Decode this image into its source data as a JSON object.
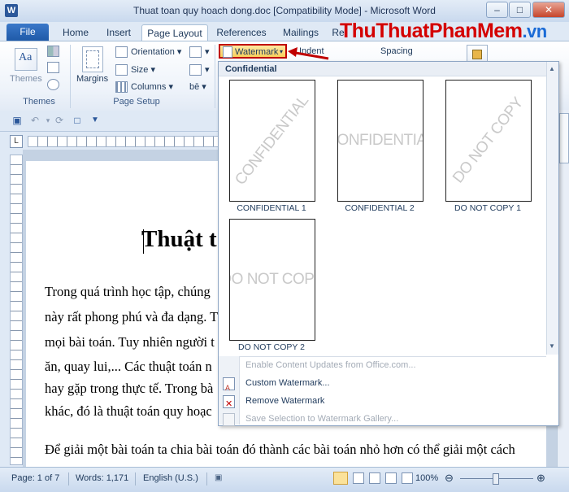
{
  "window": {
    "title": "Thuat toan quy hoach dong.doc [Compatibility Mode] - Microsoft Word",
    "app_icon": "W",
    "controls": {
      "minimize": "–",
      "maximize": "□",
      "close": "✕"
    }
  },
  "brand_watermark": {
    "main": "ThuThuatPhanMem",
    "suffix": ".vn"
  },
  "tabs": {
    "file": "File",
    "home": "Home",
    "insert": "Insert",
    "page_layout": "Page Layout",
    "references": "References",
    "mailings": "Mailings",
    "review": "Re"
  },
  "ribbon": {
    "themes": {
      "button": "Themes",
      "group": "Themes"
    },
    "page_setup": {
      "margins": "Margins",
      "orientation": "Orientation",
      "size": "Size",
      "columns": "Columns",
      "group": "Page Setup"
    },
    "watermark_button": "Watermark",
    "indent": "Indent",
    "spacing": "Spacing"
  },
  "gallery": {
    "header": "Confidential",
    "items": [
      {
        "label": "CONFIDENTIAL 1",
        "text": "CONFIDENTIAL",
        "orientation": "diagonal"
      },
      {
        "label": "CONFIDENTIAL 2",
        "text": "CONFIDENTIAL",
        "orientation": "horizontal"
      },
      {
        "label": "DO NOT COPY 1",
        "text": "DO NOT COPY",
        "orientation": "diagonal"
      },
      {
        "label": "DO NOT COPY 2",
        "text": "DO NOT COPY",
        "orientation": "horizontal"
      }
    ],
    "menu": [
      {
        "label": "Enable Content Updates from Office.com...",
        "enabled": false
      },
      {
        "label": "Custom Watermark...",
        "enabled": true
      },
      {
        "label": "Remove Watermark",
        "enabled": true
      },
      {
        "label": "Save Selection to Watermark Gallery...",
        "enabled": false
      }
    ]
  },
  "document": {
    "title": "Thuật t",
    "lines": [
      "Trong quá trình học tập, chúng",
      "này rất phong phú và đa dạng. T",
      "mọi bài toán. Tuy nhiên người t",
      "ăn, quay lui,... Các thuật toán n",
      "hay gặp trong thực tế. Trong bà",
      "khác, đó là thuật toán quy hoạc",
      "Để giải một bài toán ta chia bài toán đó thành các bài toán nhỏ hơn có thể giải một cách"
    ]
  },
  "status": {
    "page": "Page: 1 of 7",
    "words": "Words: 1,171",
    "language": "English (U.S.)",
    "zoom": "100%"
  },
  "colors": {
    "accent": "#2b579a",
    "highlight_border": "#c00000",
    "brand_red": "#d40000"
  }
}
